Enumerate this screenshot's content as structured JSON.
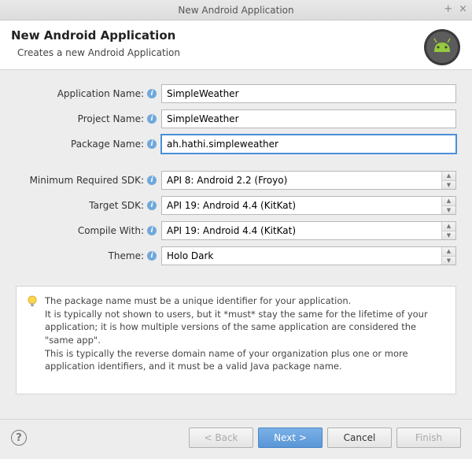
{
  "window": {
    "title": "New Android Application"
  },
  "header": {
    "title": "New Android Application",
    "subtitle": "Creates a new Android Application"
  },
  "form": {
    "app_name_label": "Application Name:",
    "app_name_value": "SimpleWeather",
    "project_name_label": "Project Name:",
    "project_name_value": "SimpleWeather",
    "package_name_label": "Package Name:",
    "package_name_value": "ah.hathi.simpleweather",
    "min_sdk_label": "Minimum Required SDK:",
    "min_sdk_value": "API 8: Android 2.2 (Froyo)",
    "target_sdk_label": "Target SDK:",
    "target_sdk_value": "API 19: Android 4.4 (KitKat)",
    "compile_with_label": "Compile With:",
    "compile_with_value": "API 19: Android 4.4 (KitKat)",
    "theme_label": "Theme:",
    "theme_value": "Holo Dark"
  },
  "hint": {
    "text": "The package name must be a unique identifier for your application.\nIt is typically not shown to users, but it *must* stay the same for the lifetime of your application; it is how multiple versions of the same application are considered the \"same app\".\nThis is typically the reverse domain name of your organization plus one or more application identifiers, and it must be a valid Java package name."
  },
  "buttons": {
    "back": "< Back",
    "next": "Next >",
    "cancel": "Cancel",
    "finish": "Finish"
  }
}
